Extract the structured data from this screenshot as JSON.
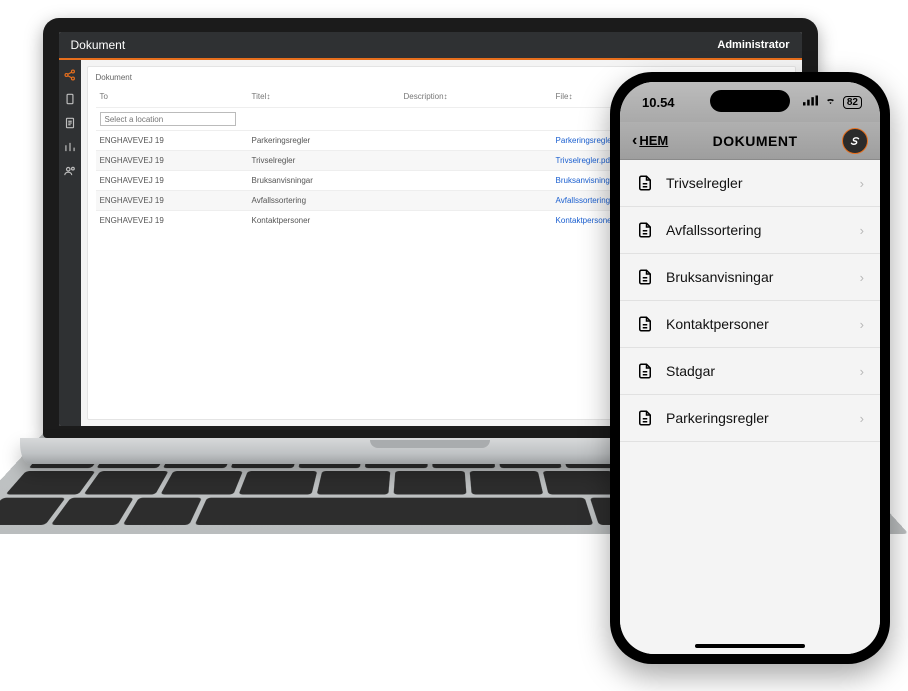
{
  "laptop": {
    "header": {
      "title": "Dokument",
      "admin": "Administrator"
    },
    "panel_title": "Dokument",
    "filter_placeholder": "Select a location",
    "columns": {
      "to": "To",
      "title": "Titel↕",
      "description": "Description↕",
      "file": "File↕"
    },
    "rows": [
      {
        "to": "ENGHAVEVEJ 19",
        "title": "Parkeringsregler",
        "desc": "",
        "file": "Parkeringsregler.pdf"
      },
      {
        "to": "ENGHAVEVEJ 19",
        "title": "Trivselregler",
        "desc": "",
        "file": "Trivselregler.pdf"
      },
      {
        "to": "ENGHAVEVEJ 19",
        "title": "Bruksanvisningar",
        "desc": "",
        "file": "Bruksanvisningar.pdf"
      },
      {
        "to": "ENGHAVEVEJ 19",
        "title": "Avfallssortering",
        "desc": "",
        "file": "Avfallssortering.pdf"
      },
      {
        "to": "ENGHAVEVEJ 19",
        "title": "Kontaktpersoner",
        "desc": "",
        "file": "Kontaktpersoner.pdf"
      }
    ]
  },
  "phone": {
    "status": {
      "time": "10.54",
      "battery": "82"
    },
    "nav": {
      "back": "HEM",
      "title": "DOKUMENT"
    },
    "docs": [
      {
        "label": "Trivselregler"
      },
      {
        "label": "Avfallssortering"
      },
      {
        "label": "Bruksanvisningar"
      },
      {
        "label": "Kontaktpersoner"
      },
      {
        "label": "Stadgar"
      },
      {
        "label": "Parkeringsregler"
      }
    ]
  }
}
